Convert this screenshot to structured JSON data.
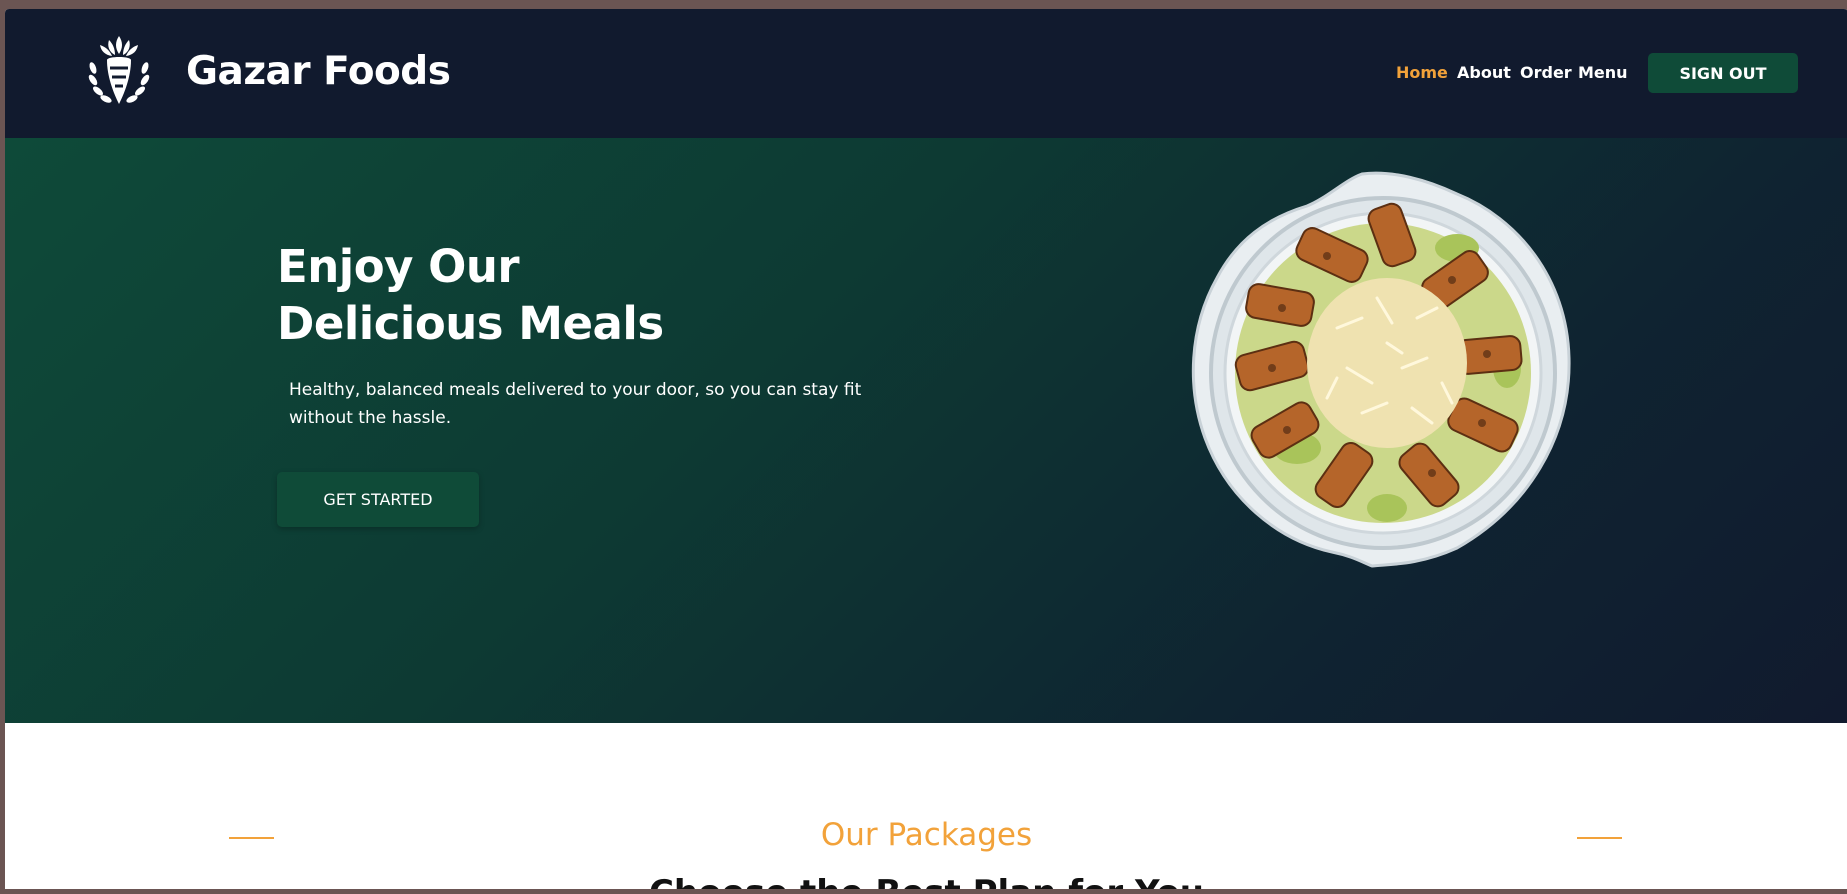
{
  "navbar": {
    "brand_name": "Gazar Foods",
    "logo_icon": "carrot-wreath-logo",
    "links": [
      {
        "label": "Home",
        "active": true
      },
      {
        "label": "About",
        "active": false
      },
      {
        "label": "Order",
        "active": false
      },
      {
        "label": "Menu",
        "active": false
      }
    ],
    "signout_label": "SIGN OUT"
  },
  "hero": {
    "title_line1": "Enjoy Our",
    "title_line2": "Delicious Meals",
    "description": "Healthy, balanced meals delivered to your door, so you can stay fit without the hassle.",
    "cta_label": "GET STARTED",
    "image_subject": "chicken-caesar-salad-bowl"
  },
  "packages": {
    "title": "Our Packages",
    "subtitle": "Choose the Best Plan for You"
  },
  "colors": {
    "accent": "#f2a23a",
    "brand_green": "#0f4b38",
    "navbar_bg": "#111a2e",
    "hero_gradient_start": "#0e4a39",
    "hero_gradient_end": "#111a2e"
  }
}
